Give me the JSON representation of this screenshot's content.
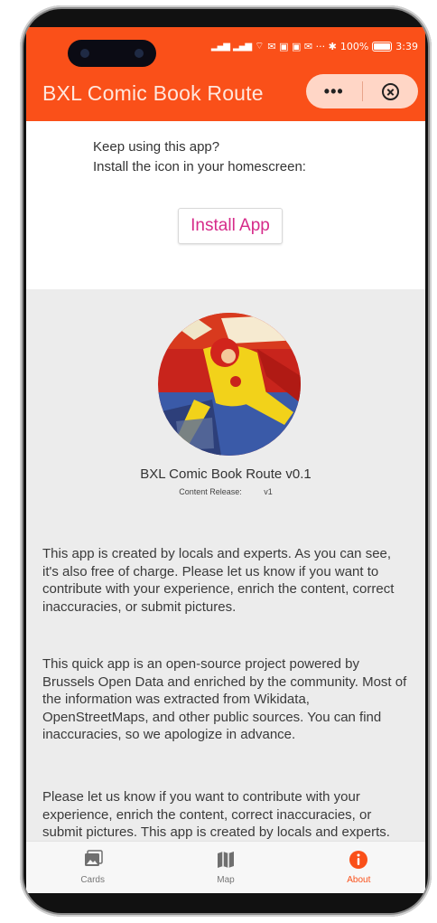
{
  "status": {
    "battery": "100%",
    "time": "3:39"
  },
  "header": {
    "title": "BXL Comic Book Route",
    "more_icon": "ellipsis-icon",
    "close_icon": "close-circle-icon"
  },
  "install": {
    "line1": "Keep using this app?",
    "line2": "Install the icon in your homescreen:",
    "button_label": "Install App"
  },
  "about": {
    "app_name": "BXL Comic Book Route v0.1",
    "release_label": "Content Release:",
    "release_value": "v1",
    "paragraphs": [
      "This app is created by locals and experts. As you can see, it's also free of charge. Please let us know if you want to contribute with your experience, enrich the content, correct inaccuracies, or submit pictures.",
      "This quick app is an open-source project powered by Brussels Open Data and enriched by the community. Most of the information was extracted from Wikidata, OpenStreetMaps, and other public sources. You can find inaccuracies, so we apologize in advance.",
      "Please let us know if you want to contribute with your experience, enrich the content, correct inaccuracies, or submit pictures. This app is created by locals and experts."
    ]
  },
  "tabs": [
    {
      "label": "Cards",
      "icon": "image-icon"
    },
    {
      "label": "Map",
      "icon": "map-icon"
    },
    {
      "label": "About",
      "icon": "info-icon"
    }
  ],
  "colors": {
    "header": "#fa5019",
    "accent": "#d62b8a",
    "active_tab": "#fa5019"
  }
}
